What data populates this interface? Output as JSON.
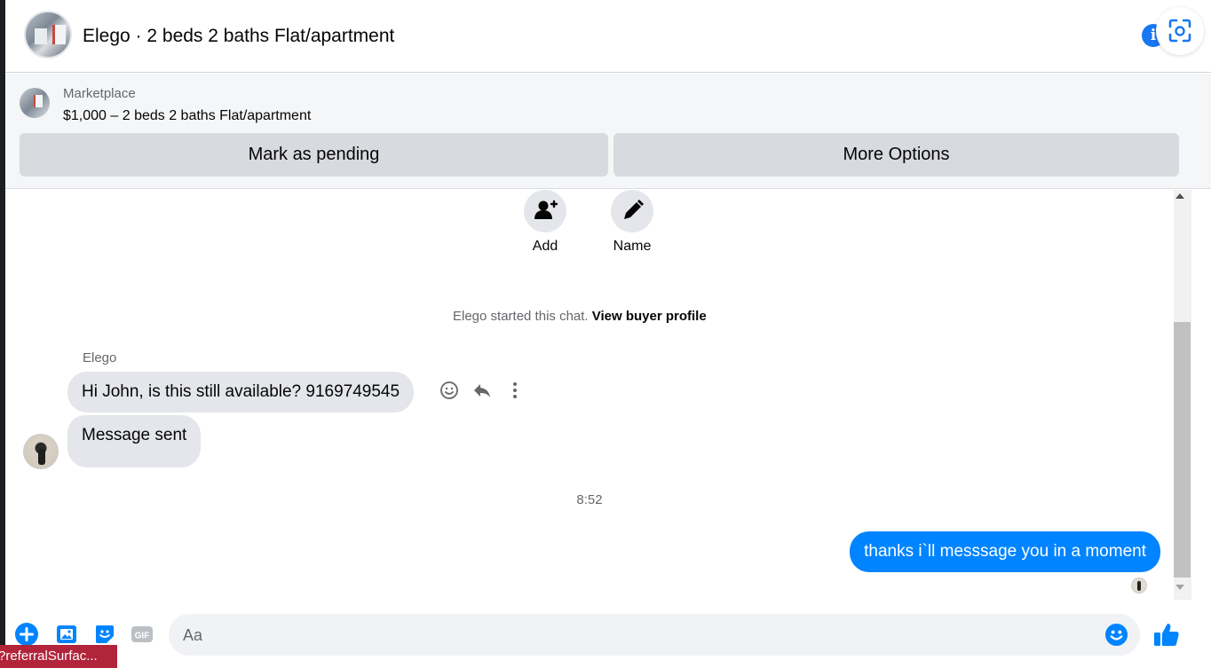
{
  "header": {
    "title": "Elego · 2 beds 2 baths Flat/apartment",
    "info_icon": "info-icon",
    "screenshot_icon": "screenshot-scan-icon"
  },
  "marketplace": {
    "label": "Marketplace",
    "listing": "$1,000 – 2 beds 2 baths Flat/apartment",
    "mark_pending_label": "Mark as pending",
    "more_options_label": "More Options"
  },
  "actions": {
    "add_label": "Add",
    "name_label": "Name"
  },
  "chat": {
    "started_text": "Elego started this chat.",
    "view_profile_link": "View buyer profile",
    "sender_name": "Elego",
    "messages_in": [
      "Hi John, is this still available? 9169749545",
      "Message sent"
    ],
    "timestamp": "8:52",
    "message_out": "thanks i`ll messsage you in a moment"
  },
  "composer": {
    "placeholder": "Aa",
    "icons": [
      "plus-circle-icon",
      "photo-icon",
      "sticker-icon",
      "gif-icon",
      "emoji-icon",
      "thumbs-up-icon"
    ]
  },
  "tooltip": {
    "text": "?referralSurfac..."
  },
  "colors": {
    "accent": "#0084ff",
    "brand_blue": "#1877f2",
    "button_gray": "#d8dadf",
    "bubble_gray": "#e4e6eb"
  }
}
